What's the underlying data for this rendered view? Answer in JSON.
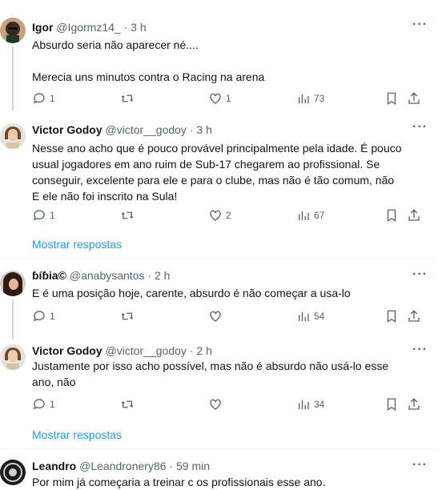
{
  "replies": [
    {
      "name": "Igor",
      "handle": "@Igormz14_",
      "separator": "·",
      "time": "3 h",
      "lines": [
        "Absurdo seria não aparecer né....",
        "",
        "Merecia uns minutos contra o Racing na arena"
      ],
      "comments": "1",
      "retweets": "",
      "likes": "1",
      "views": "73"
    },
    {
      "name": "Victor Godoy",
      "handle": "@victor__godoy",
      "separator": "·",
      "time": "3 h",
      "lines": [
        "Nesse ano acho que é pouco provável principalmente pela idade. É pouco",
        "usual jogadores em ano ruim de Sub-17 chegarem ao profissional. Se",
        "conseguir, excelente para ele e para o clube, mas não é tão comum, não",
        "E ele não foi inscrito na Sula!"
      ],
      "comments": "1",
      "retweets": "",
      "likes": "2",
      "views": "67"
    },
    {
      "name": "ɓíɓia©",
      "handle": "@anabysantos",
      "separator": "·",
      "time": "2 h",
      "lines": [
        "E é uma posição hoje, carente, absurdo é não começar a usa-lo"
      ],
      "comments": "1",
      "retweets": "",
      "likes": "",
      "views": "54"
    },
    {
      "name": "Victor Godoy",
      "handle": "@victor__godoy",
      "separator": "·",
      "time": "2 h",
      "lines": [
        "Justamente por isso acho possível, mas não é absurdo não usá-lo esse",
        "ano, não"
      ],
      "comments": "1",
      "retweets": "",
      "likes": "",
      "views": "34"
    },
    {
      "name": "Leandro",
      "handle": "@Leandronery86",
      "separator": "·",
      "time": "59 min",
      "lines": [
        "Por mim já começaria a treinar c os profissionais esse ano."
      ]
    }
  ],
  "show_more": "Mostrar respostas",
  "more_icon": "more-horizontal-icon",
  "colors": {
    "link": "#1d9bf0",
    "muted": "#536471",
    "line": "#cfd9de"
  }
}
